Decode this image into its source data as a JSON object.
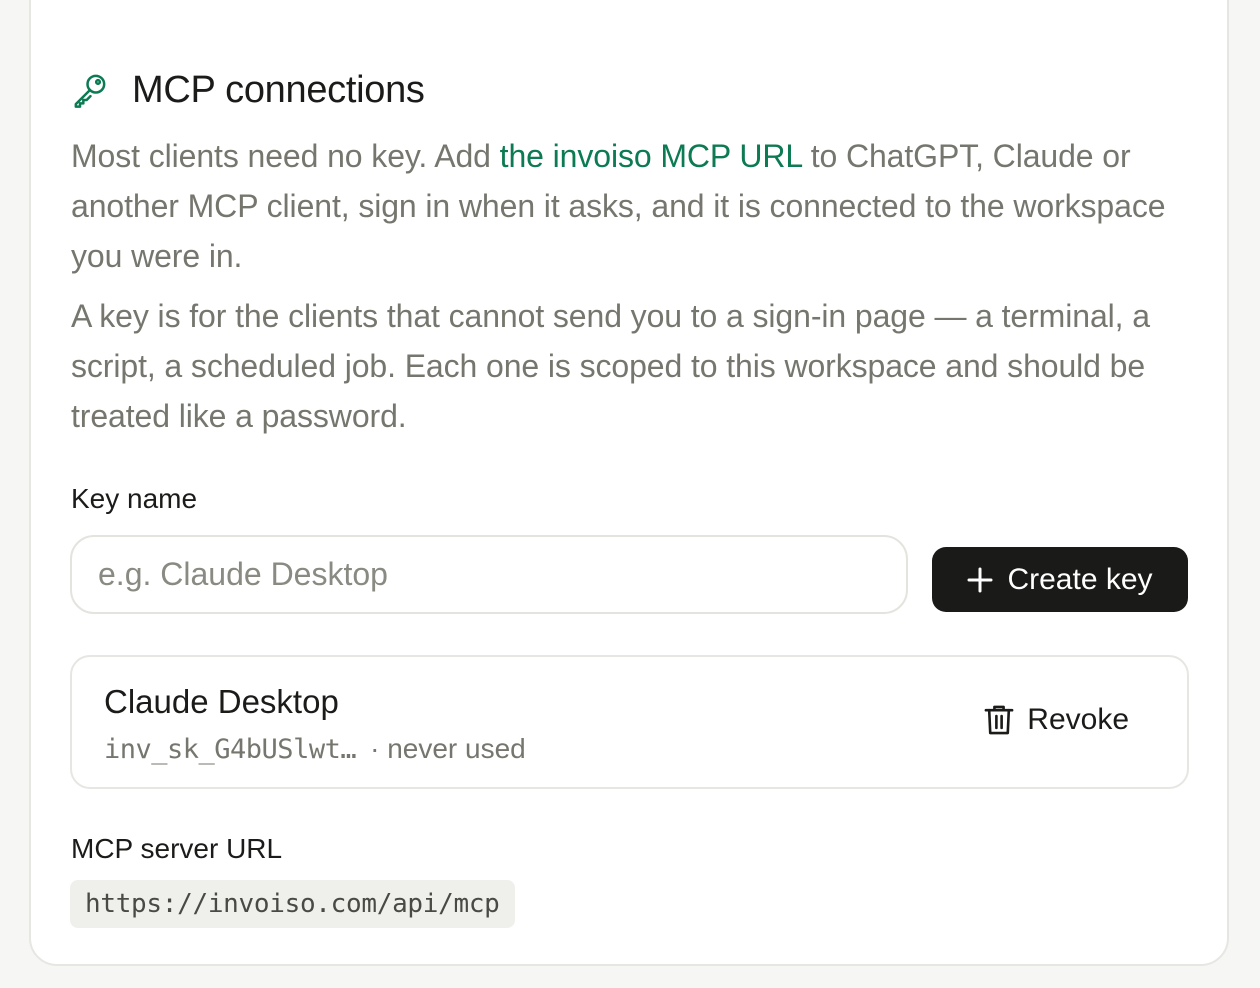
{
  "section": {
    "title": "MCP connections",
    "icon": "key-icon",
    "accent_color": "#0c7a52"
  },
  "intro": {
    "before_link": "Most clients need no key. Add ",
    "link_text": "the invoiso MCP URL",
    "after_link": " to ChatGPT, Claude or another MCP client, sign in when it asks, and it is connected to the workspace you were in.",
    "second": "A key is for the clients that cannot send you to a sign-in page — a terminal, a script, a scheduled job. Each one is scoped to this workspace and should be treated like a password."
  },
  "form": {
    "key_name_label": "Key name",
    "key_name_value": "",
    "key_name_placeholder": "e.g. Claude Desktop",
    "create_label": "Create key"
  },
  "keys": [
    {
      "name": "Claude Desktop",
      "prefix": "inv_sk_G4bUSlwt…",
      "status": "· never used",
      "revoke_label": "Revoke"
    }
  ],
  "server": {
    "label": "MCP server URL",
    "url": "https://invoiso.com/api/mcp"
  }
}
